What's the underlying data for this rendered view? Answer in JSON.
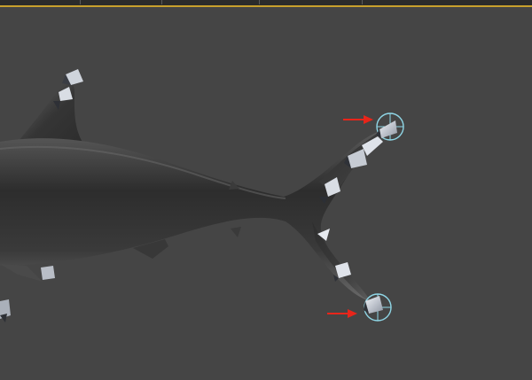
{
  "viewport": {
    "name": "3D viewport",
    "colors": {
      "background": "#454545",
      "top_bar": "#2b2b2b",
      "active_border": "#c8a02c",
      "mesh_dark": "#2a2a2a",
      "mesh_light": "#6e6e6e",
      "bone_light": "#dfe3ea",
      "bone_dark": "#3a3d44",
      "ik_helper": "#8fd6e6",
      "annotation_arrow": "#e8251a"
    },
    "objects": [
      {
        "name": "shark-body-mesh",
        "icon": "mesh"
      },
      {
        "name": "dorsal-fin-bones",
        "icon": "bone-chain"
      },
      {
        "name": "tail-upper-bones",
        "icon": "bone-chain"
      },
      {
        "name": "tail-lower-bones",
        "icon": "bone-chain"
      },
      {
        "name": "ik-helper-upper",
        "icon": "circle-helper"
      },
      {
        "name": "ik-helper-lower",
        "icon": "circle-helper"
      }
    ],
    "annotations": [
      {
        "name": "arrow-upper-helper",
        "icon": "arrow-right"
      },
      {
        "name": "arrow-lower-helper",
        "icon": "arrow-right"
      }
    ]
  }
}
